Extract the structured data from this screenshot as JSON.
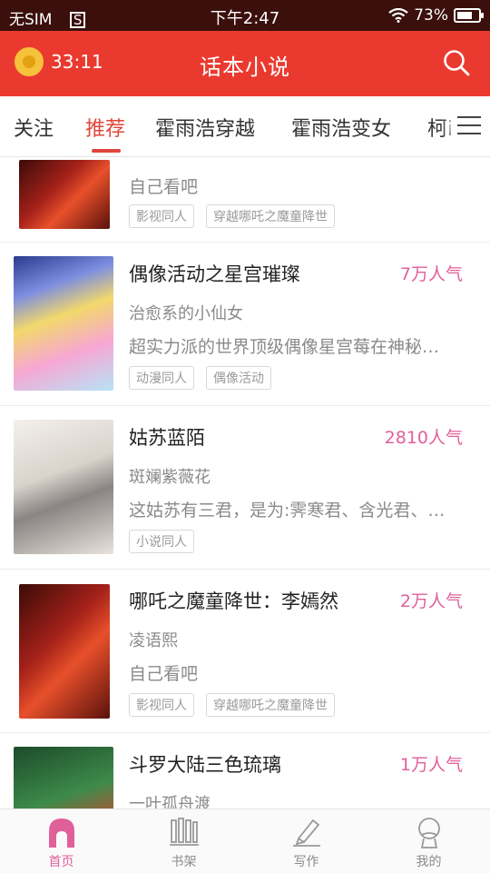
{
  "status": {
    "carrier": "无SIM",
    "sim_glyph": "S",
    "time": "下午2:47",
    "battery": "73%"
  },
  "appbar": {
    "timer": "33:11",
    "title": "话本小说"
  },
  "tabs": [
    "关注",
    "推荐",
    "霍雨浩穿越",
    "霍雨浩变女",
    "柯i"
  ],
  "feed": [
    {
      "title": "",
      "popularity": "",
      "author": "",
      "desc": "自己看吧",
      "tags": [
        "影视同人",
        "穿越哪吒之魔童降世"
      ]
    },
    {
      "title": "偶像活动之星宫璀璨",
      "popularity": "7万人气",
      "author": "治愈系的小仙女",
      "desc": "超实力派的世界顶级偶像星宫莓在神秘…",
      "tags": [
        "动漫同人",
        "偶像活动"
      ]
    },
    {
      "title": "姑苏蓝陌",
      "popularity": "2810人气",
      "author": "斑斓紫薇花",
      "desc": "这姑苏有三君，是为:霁寒君、含光君、…",
      "tags": [
        "小说同人"
      ]
    },
    {
      "title": "哪吒之魔童降世：李嫣然",
      "popularity": "2万人气",
      "author": "凌语熙",
      "desc": "自己看吧",
      "tags": [
        "影视同人",
        "穿越哪吒之魔童降世"
      ]
    },
    {
      "title": "斗罗大陆三色琉璃",
      "popularity": "1万人气",
      "author": "一叶孤舟渡",
      "desc": "",
      "tags": []
    }
  ],
  "bottom_nav": [
    {
      "label": "首页",
      "icon": "home-icon",
      "active": true
    },
    {
      "label": "书架",
      "icon": "bookshelf-icon",
      "active": false
    },
    {
      "label": "写作",
      "icon": "pen-icon",
      "active": false
    },
    {
      "label": "我的",
      "icon": "profile-icon",
      "active": false
    }
  ],
  "colors": {
    "appbar": "#ea3a2f",
    "accent": "#e0453a",
    "popularity": "#e0609a"
  }
}
